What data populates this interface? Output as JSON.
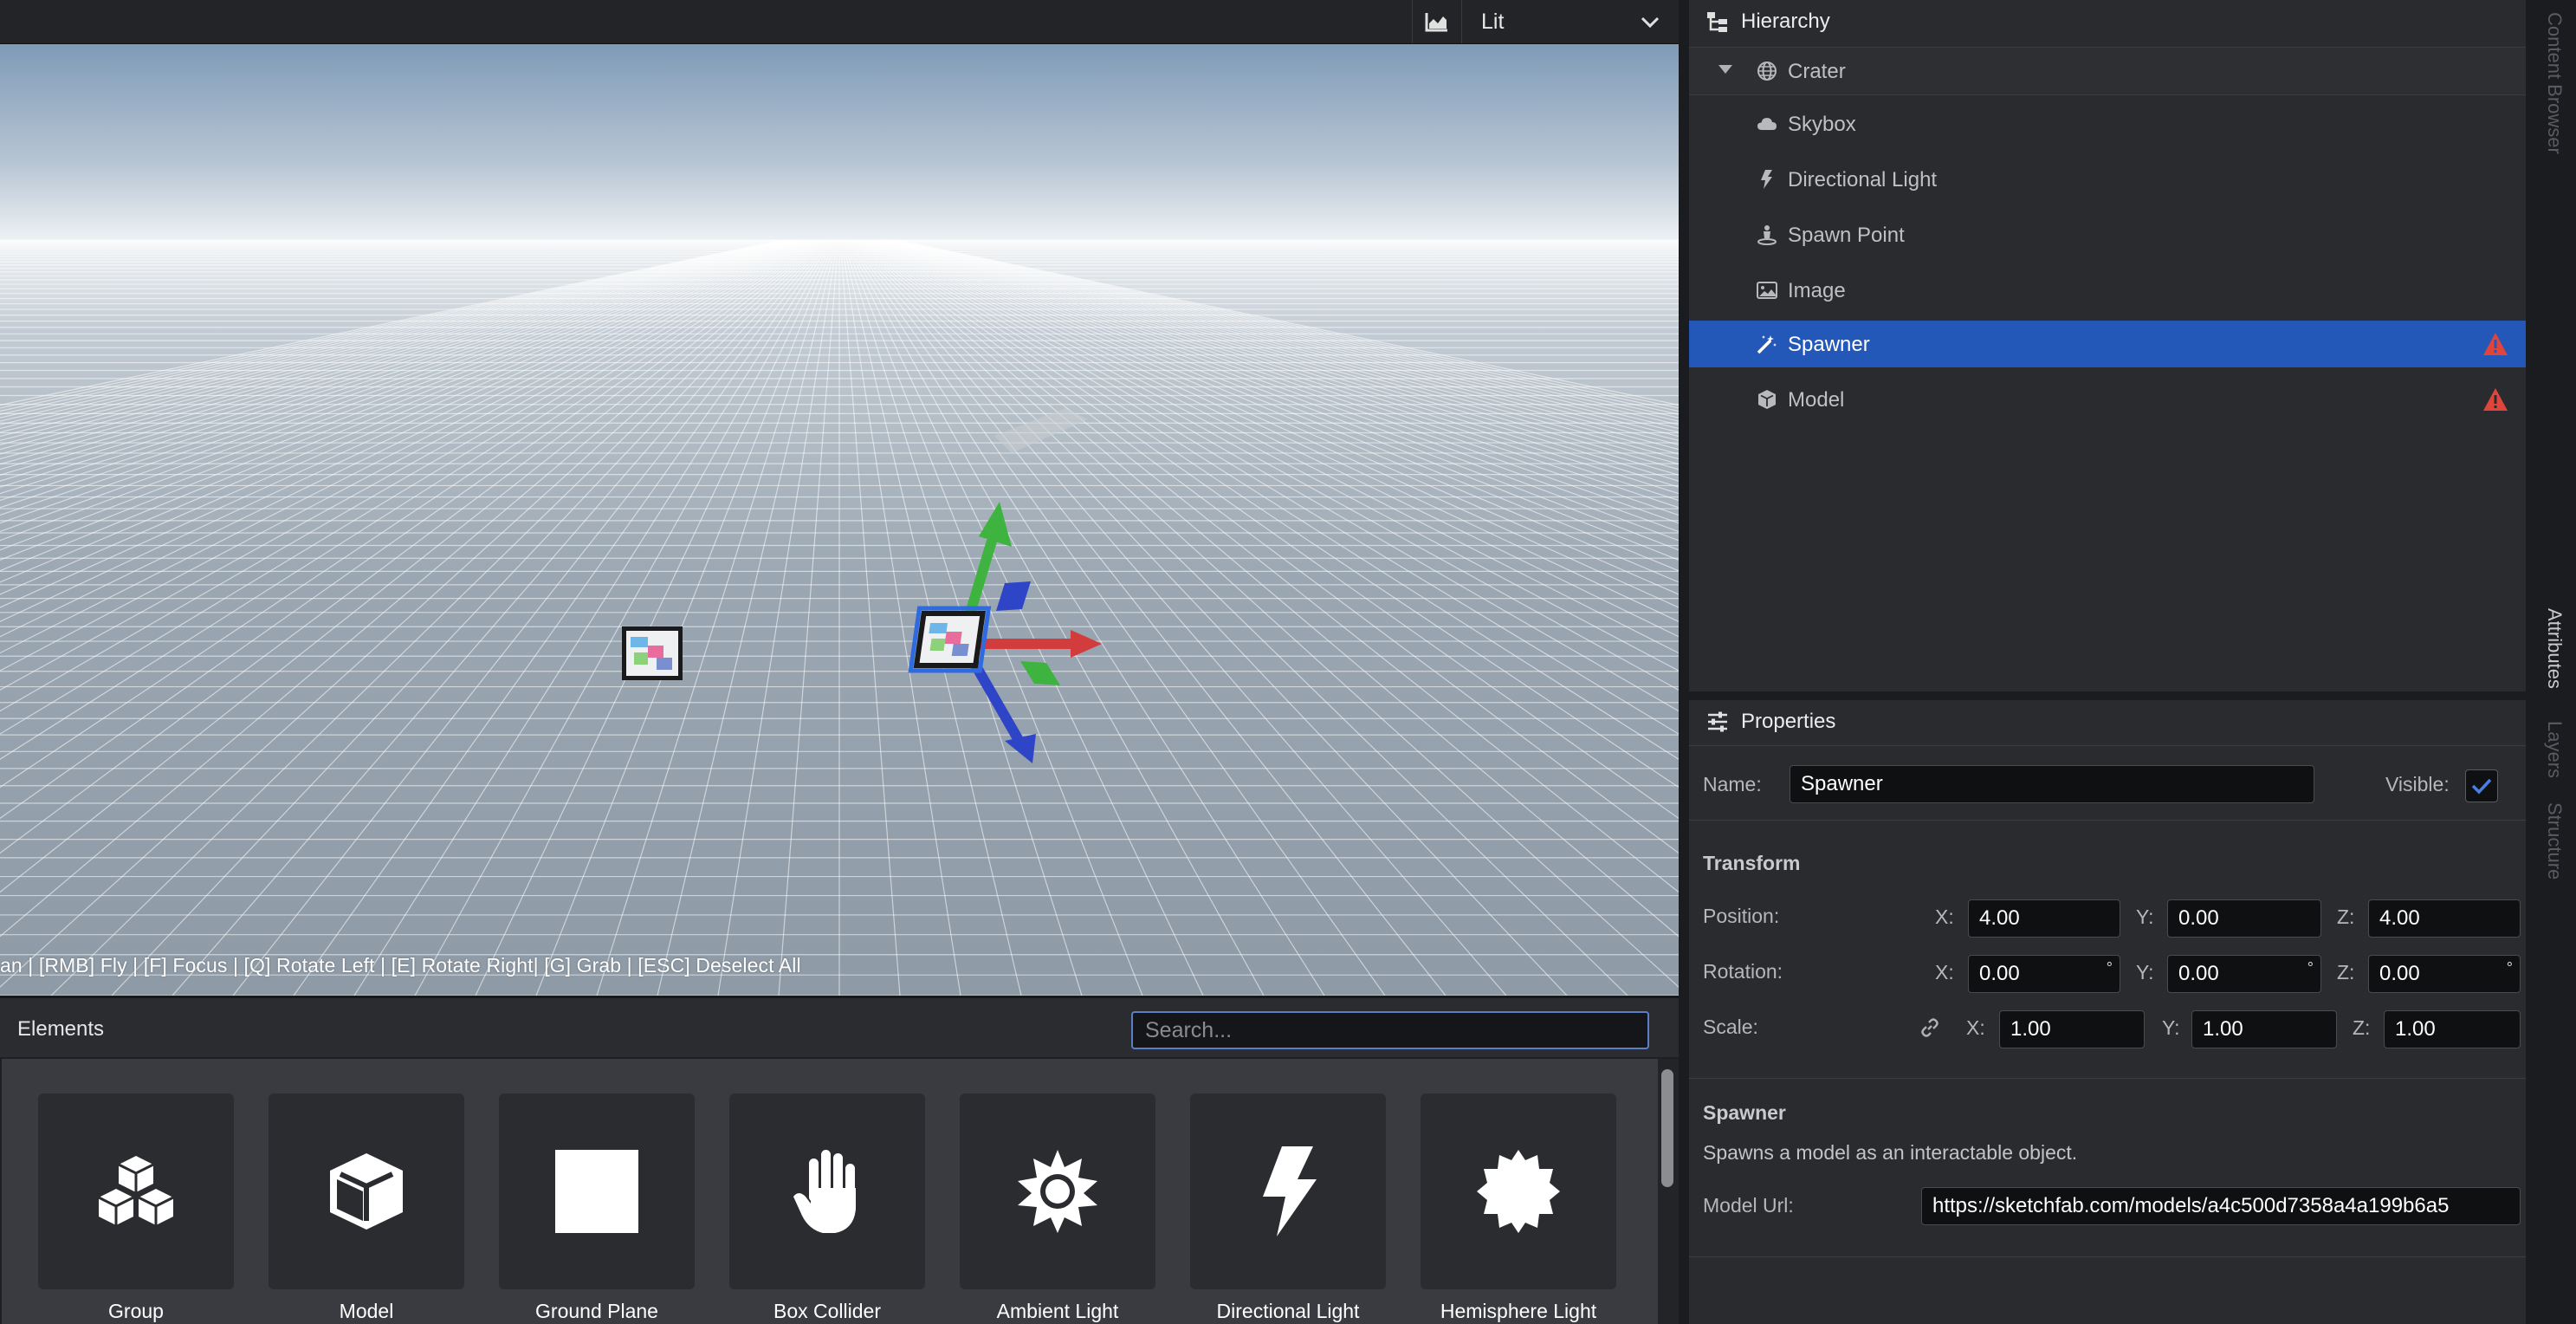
{
  "toolbar": {
    "stats_icon": "chart-icon",
    "shading_mode": "Lit"
  },
  "viewport": {
    "hint": "an | [RMB] Fly | [F] Focus | [Q] Rotate Left | [E] Rotate Right| [G] Grab | [ESC] Deselect All"
  },
  "elements": {
    "title": "Elements",
    "search_placeholder": "Search...",
    "items": [
      {
        "label": "Group",
        "icon": "cubes-icon"
      },
      {
        "label": "Model",
        "icon": "cube-icon"
      },
      {
        "label": "Ground Plane",
        "icon": "square-icon"
      },
      {
        "label": "Box Collider",
        "icon": "hand-icon"
      },
      {
        "label": "Ambient Light",
        "icon": "sun-icon"
      },
      {
        "label": "Directional Light",
        "icon": "bolt-icon"
      },
      {
        "label": "Hemisphere Light",
        "icon": "burst-icon"
      }
    ]
  },
  "hierarchy": {
    "title": "Hierarchy",
    "root": {
      "label": "Crater",
      "icon": "globe-icon"
    },
    "items": [
      {
        "label": "Skybox",
        "icon": "cloud-icon",
        "warning": false
      },
      {
        "label": "Directional Light",
        "icon": "bolt-icon",
        "warning": false
      },
      {
        "label": "Spawn Point",
        "icon": "spawn-icon",
        "warning": false
      },
      {
        "label": "Image",
        "icon": "image-icon",
        "warning": false
      },
      {
        "label": "Spawner",
        "icon": "magic-wand-icon",
        "warning": true,
        "selected": true
      },
      {
        "label": "Model",
        "icon": "cube-icon",
        "warning": true
      }
    ]
  },
  "properties": {
    "title": "Properties",
    "name_label": "Name:",
    "name_value": "Spawner",
    "visible_label": "Visible:",
    "visible": true,
    "transform_title": "Transform",
    "position_label": "Position:",
    "rotation_label": "Rotation:",
    "scale_label": "Scale:",
    "axis": {
      "x": "X:",
      "y": "Y:",
      "z": "Z:"
    },
    "position": {
      "x": "4.00",
      "y": "0.00",
      "z": "4.00"
    },
    "rotation": {
      "x": "0.00",
      "y": "0.00",
      "z": "0.00"
    },
    "degree": "°",
    "scale": {
      "x": "1.00",
      "y": "1.00",
      "z": "1.00"
    },
    "component_title": "Spawner",
    "component_desc": "Spawns a model as an interactable object.",
    "model_url_label": "Model Url:",
    "model_url": "https://sketchfab.com/models/a4c500d7358a4a199b6a5"
  },
  "side_tabs": {
    "content_browser": "Content Browser",
    "attributes": "Attributes",
    "layers": "Layers",
    "structure": "Structure"
  },
  "colors": {
    "accent": "#2358b8",
    "warning": "#e0443a",
    "gizmo_x": "#d23c3c",
    "gizmo_y": "#3fb33f",
    "gizmo_z": "#2f45c8"
  }
}
